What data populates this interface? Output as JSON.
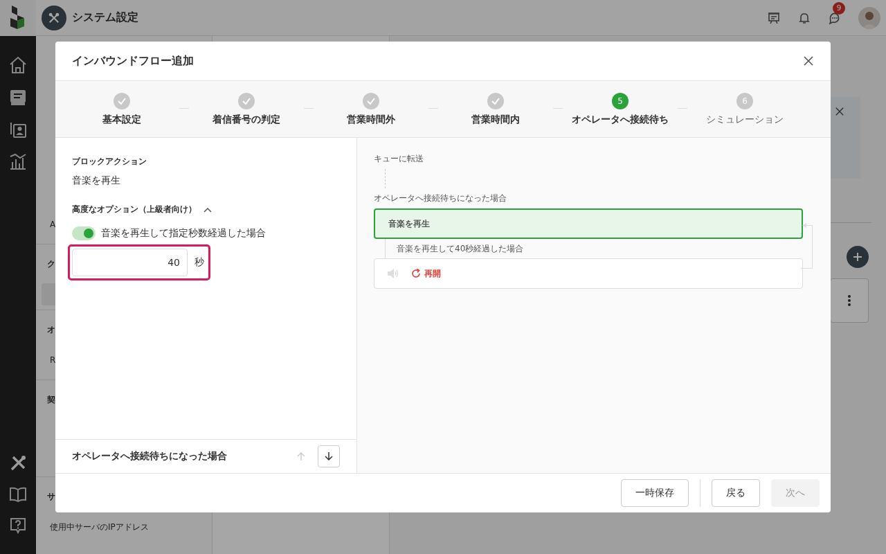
{
  "app_header": {
    "title": "システム設定",
    "notification_badge": "9"
  },
  "settings_nav": [
    {
      "kind": "item",
      "label": "A",
      "selected": false
    },
    {
      "kind": "heading",
      "label": "ク"
    },
    {
      "kind": "item",
      "selected": true
    },
    {
      "kind": "heading",
      "label": "オ"
    },
    {
      "kind": "item",
      "label": "R",
      "selected": false
    },
    {
      "kind": "heading",
      "label": "契"
    },
    {
      "kind": "heading",
      "label": "サ"
    },
    {
      "kind": "item",
      "label": "使用中サーバのIPアドレス",
      "selected": false
    }
  ],
  "modal": {
    "title": "インバウンドフロー追加",
    "steps": [
      {
        "label": "基本設定",
        "done": true,
        "selected": false
      },
      {
        "label": "着信番号の判定",
        "done": true,
        "selected": false
      },
      {
        "label": "営業時間外",
        "done": true,
        "selected": false
      },
      {
        "label": "営業時間内",
        "done": true,
        "selected": false
      },
      {
        "number": "5",
        "label": "オペレータへ接続待ち",
        "done": false,
        "selected": true
      },
      {
        "number": "6",
        "label": "シミュレーション",
        "done": false,
        "selected": false
      }
    ],
    "block_action": {
      "label": "ブロックアクション",
      "value": "音楽を再生"
    },
    "advanced_options": {
      "label": "高度なオプション（上級者向け）",
      "expanded": true
    },
    "wait_option": {
      "on": true,
      "label": "音楽を再生して指定秒数経過した場合",
      "seconds": "40",
      "unit": "秒",
      "highlighted": true
    },
    "block_nav": {
      "title": "オペレータへ接続待ちになった場合",
      "up_disabled": true,
      "down_disabled": false
    },
    "flow": {
      "parent_label": "キューに転送",
      "branch_label": "オペレータへ接続待ちになった場合",
      "block": {
        "label": "音楽を再生",
        "selected": true
      },
      "sub_branch_label": "音楽を再生して40秒経過した場合",
      "sub_block": {
        "action_label": "再開"
      }
    },
    "buttons": [
      {
        "label": "一時保存",
        "disabled": false
      },
      {
        "label": "戻る",
        "disabled": false
      },
      {
        "label": "次へ",
        "disabled": true
      }
    ]
  }
}
